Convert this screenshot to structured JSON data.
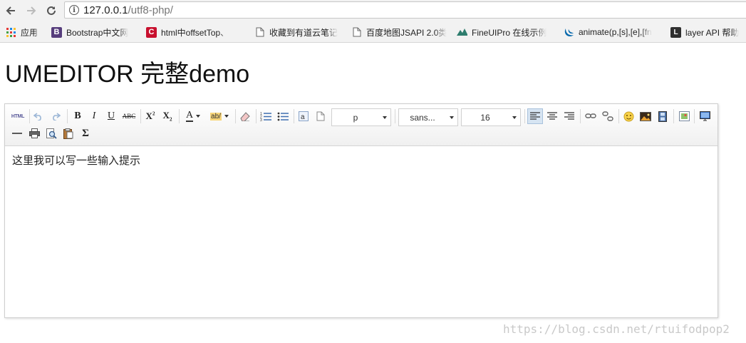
{
  "browser": {
    "url_host": "127.0.0.1",
    "url_path": "/utf8-php/",
    "bookmarks": [
      {
        "label": "应用",
        "icon": "apps-grid-icon"
      },
      {
        "label": "Bootstrap中文网",
        "icon": "bootstrap-icon"
      },
      {
        "label": "html中offsetTop、",
        "icon": "csdn-icon"
      },
      {
        "label": "收藏到有道云笔记",
        "icon": "page-icon"
      },
      {
        "label": "百度地图JSAPI 2.0类",
        "icon": "page-icon"
      },
      {
        "label": "FineUIPro 在线示例",
        "icon": "fineui-icon"
      },
      {
        "label": "animate(p,[s],[e],[fn",
        "icon": "jquery-icon"
      },
      {
        "label": "layer API 帮助",
        "icon": "layer-icon"
      }
    ]
  },
  "page": {
    "title": "UMEDITOR 完整demo"
  },
  "editor": {
    "paragraph_value": "p",
    "font_family_value": "sans...",
    "font_size_value": "16",
    "content_text": "这里我可以写一些输入提示"
  },
  "watermark": "https://blog.csdn.net/rtuifodpop2",
  "colors": {
    "active_button_bg": "#d6e4f2",
    "toolbar_border": "#d4d4d4"
  }
}
